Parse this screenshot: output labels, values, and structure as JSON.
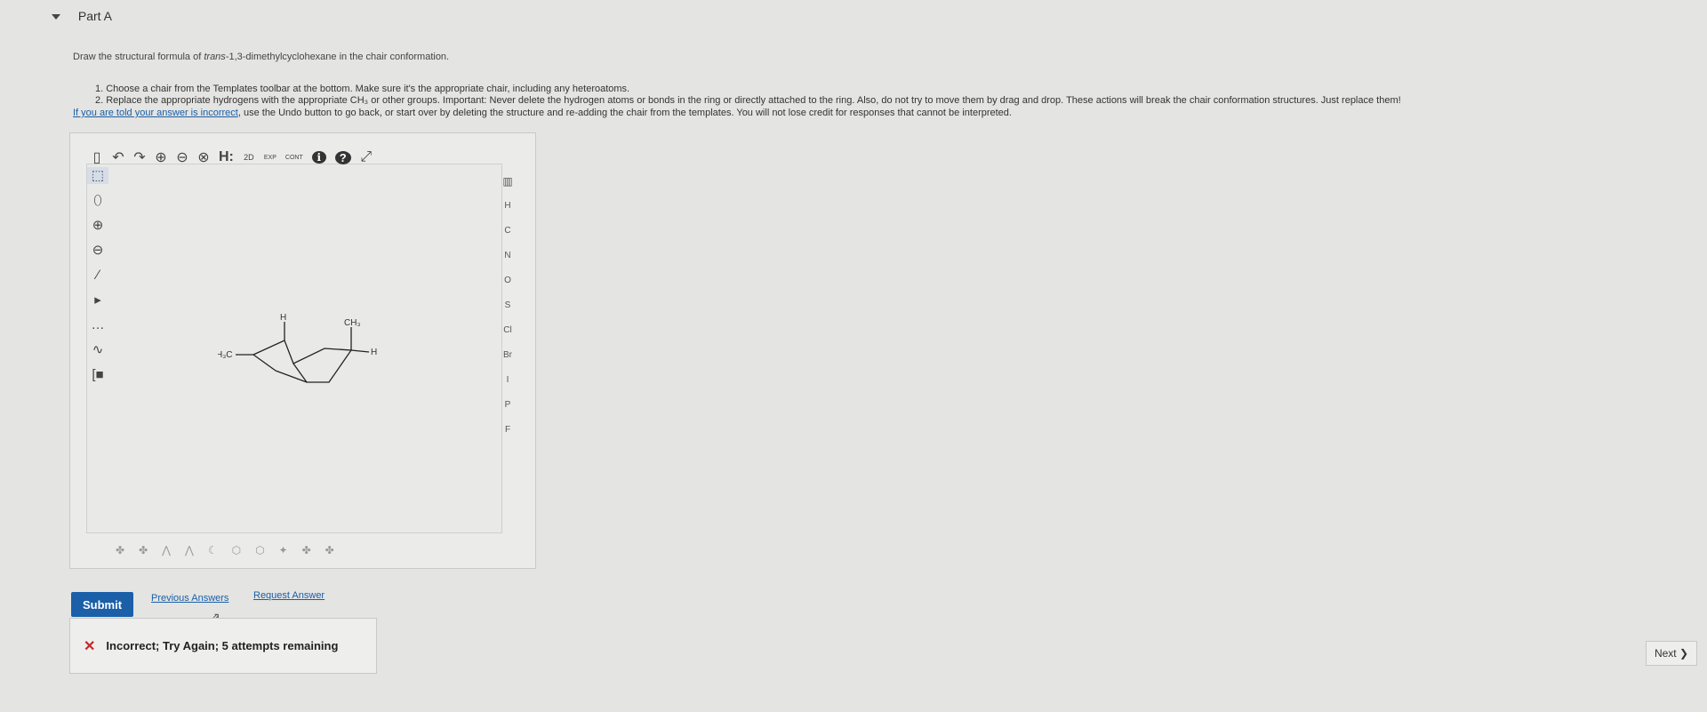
{
  "part": {
    "title": "Part A"
  },
  "question": {
    "prefix": "Draw the structural formula of ",
    "compound": "trans",
    "suffix": "-1,3-dimethylcyclohexane in the chair conformation."
  },
  "instructions": {
    "line1": "1. Choose a chair from the Templates toolbar at the bottom. Make sure it's the appropriate chair, including any heteroatoms.",
    "line2": "2. Replace the appropriate hydrogens with the appropriate CH₃ or other groups. Important: Never delete the hydrogen atoms or bonds in the ring or directly attached to the ring. Also, do not try to move them by drag and drop. These actions will break the chair conformation structures. Just replace them!",
    "hint_link": "If you are told your answer is incorrect",
    "hint_rest": ", use the Undo button to go back, or start over by deleting the structure and re-adding the chair from the templates. You will not lose credit for responses that cannot be interpreted."
  },
  "toolbar": {
    "top": [
      {
        "name": "new-document-icon",
        "glyph": "▯"
      },
      {
        "name": "undo-icon",
        "glyph": "↶"
      },
      {
        "name": "redo-icon",
        "glyph": "↷"
      },
      {
        "name": "zoom-in-icon",
        "glyph": "⊕"
      },
      {
        "name": "zoom-out-icon",
        "glyph": "⊖"
      },
      {
        "name": "zoom-reset-icon",
        "glyph": "⊗"
      },
      {
        "name": "explicit-hydrogens-icon",
        "glyph": "H:"
      },
      {
        "name": "2d-view-icon",
        "glyph": "2D"
      },
      {
        "name": "exp-icon",
        "glyph": "EXP"
      },
      {
        "name": "cont-icon",
        "glyph": "CONT"
      },
      {
        "name": "info-icon",
        "glyph": "ℹ"
      },
      {
        "name": "help-icon",
        "glyph": "?"
      },
      {
        "name": "fullscreen-icon",
        "glyph": "⤢"
      }
    ],
    "left": [
      {
        "name": "select-tool-icon",
        "glyph": "⬚"
      },
      {
        "name": "eraser-icon",
        "glyph": "⬯"
      },
      {
        "name": "positive-charge-icon",
        "glyph": "⊕"
      },
      {
        "name": "negative-charge-icon",
        "glyph": "⊖"
      },
      {
        "name": "single-bond-icon",
        "glyph": "∕"
      },
      {
        "name": "wedge-bond-icon",
        "glyph": "▸"
      },
      {
        "name": "hash-bond-icon",
        "glyph": "…"
      },
      {
        "name": "chain-icon",
        "glyph": "∿"
      },
      {
        "name": "bracket-icon",
        "glyph": "[■"
      }
    ],
    "periodic_icon": "periodic-table-icon",
    "elements": [
      "H",
      "C",
      "N",
      "O",
      "S",
      "Cl",
      "Br",
      "I",
      "P",
      "F"
    ],
    "templates": [
      "✤",
      "✤",
      "⋀",
      "⋀",
      "☾",
      "⬡",
      "⬡",
      "✦",
      "✤",
      "✤"
    ]
  },
  "molecule": {
    "label_h_top": "H",
    "label_ch3_top": "CH₃",
    "label_h3c": "H₃C",
    "label_h_right": "H"
  },
  "actions": {
    "submit": "Submit",
    "previous_answers": "Previous Answers",
    "request_answer": "Request Answer"
  },
  "feedback": {
    "icon": "x-mark-icon",
    "message": "Incorrect; Try Again; 5 attempts remaining"
  },
  "nav": {
    "next": "Next ❯"
  }
}
